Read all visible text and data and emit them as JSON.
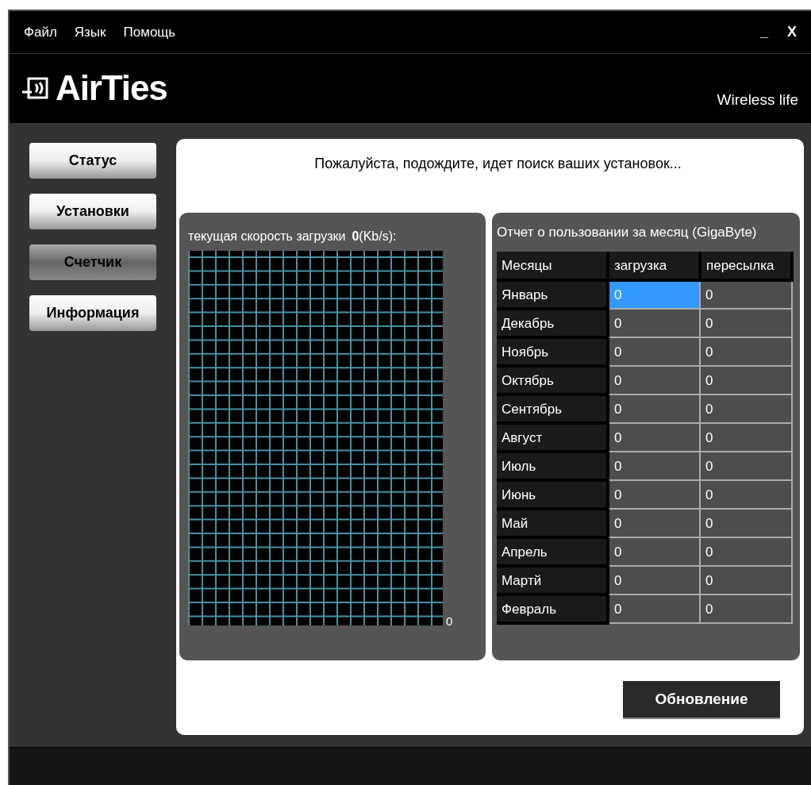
{
  "menu": [
    "Файл",
    "Язык",
    "Помощь"
  ],
  "window_controls": {
    "minimize": "_",
    "close": "X"
  },
  "header": {
    "logo": "AirTies",
    "tagline": "Wireless life"
  },
  "sidebar": {
    "items": [
      {
        "label": "Статус",
        "selected": false
      },
      {
        "label": "Установки",
        "selected": false
      },
      {
        "label": "Счетчик",
        "selected": true
      },
      {
        "label": "Информация",
        "selected": false
      }
    ]
  },
  "message": "Пожалуйста, подождите, идет поиск ваших установок...",
  "speed_panel": {
    "label": "текущая скорость загрузки",
    "value": "0",
    "unit": "(Kb/s):",
    "axis_label": "0"
  },
  "usage_panel": {
    "title": "Отчет о пользовании за месяц (GigaByte)",
    "columns": [
      "Месяцы",
      "загрузка",
      "пересылка"
    ],
    "rows": [
      {
        "cells": [
          {
            "text": "Январь",
            "selected": false
          },
          {
            "text": "0",
            "selected": true
          },
          {
            "text": "0",
            "selected": false
          }
        ]
      },
      {
        "cells": [
          {
            "text": "Декабрь",
            "selected": false
          },
          {
            "text": "0",
            "selected": false
          },
          {
            "text": "0",
            "selected": false
          }
        ]
      },
      {
        "cells": [
          {
            "text": "Ноябрь",
            "selected": false
          },
          {
            "text": "0",
            "selected": false
          },
          {
            "text": "0",
            "selected": false
          }
        ]
      },
      {
        "cells": [
          {
            "text": "Октябрь",
            "selected": false
          },
          {
            "text": "0",
            "selected": false
          },
          {
            "text": "0",
            "selected": false
          }
        ]
      },
      {
        "cells": [
          {
            "text": "Сентябрь",
            "selected": false
          },
          {
            "text": "0",
            "selected": false
          },
          {
            "text": "0",
            "selected": false
          }
        ]
      },
      {
        "cells": [
          {
            "text": "Август",
            "selected": false
          },
          {
            "text": "0",
            "selected": false
          },
          {
            "text": "0",
            "selected": false
          }
        ]
      },
      {
        "cells": [
          {
            "text": "Июль",
            "selected": false
          },
          {
            "text": "0",
            "selected": false
          },
          {
            "text": "0",
            "selected": false
          }
        ]
      },
      {
        "cells": [
          {
            "text": "Июнь",
            "selected": false
          },
          {
            "text": "0",
            "selected": false
          },
          {
            "text": "0",
            "selected": false
          }
        ]
      },
      {
        "cells": [
          {
            "text": "Май",
            "selected": false
          },
          {
            "text": "0",
            "selected": false
          },
          {
            "text": "0",
            "selected": false
          }
        ]
      },
      {
        "cells": [
          {
            "text": "Апрель",
            "selected": false
          },
          {
            "text": "0",
            "selected": false
          },
          {
            "text": "0",
            "selected": false
          }
        ]
      },
      {
        "cells": [
          {
            "text": "Мартй",
            "selected": false
          },
          {
            "text": "0",
            "selected": false
          },
          {
            "text": "0",
            "selected": false
          }
        ]
      },
      {
        "cells": [
          {
            "text": "Февраль",
            "selected": false
          },
          {
            "text": "0",
            "selected": false
          },
          {
            "text": "0",
            "selected": false
          }
        ]
      }
    ]
  },
  "refresh_button": "Обновление"
}
